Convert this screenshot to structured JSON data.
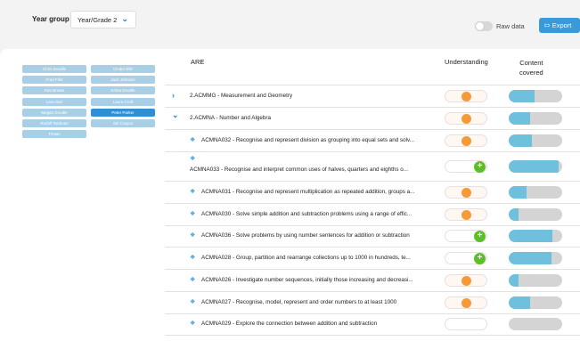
{
  "topbar": {
    "year_label": "Year group",
    "year_value": "Year/Grade 2",
    "raw_label": "Raw data",
    "export_label": "Export"
  },
  "students": [
    "Chris Doodle",
    "Cinder Elle",
    "Fred Flint",
    "Jack Johnson",
    "Ken Brown",
    "Krista Doodle",
    "Lara Star",
    "Laura Croft",
    "Megan Doodle",
    "Peter Parker",
    "Rodolf Redman",
    "Siri Crayon",
    "Tristan"
  ],
  "selected_student": "Peter Parker",
  "table": {
    "col_are": "ARE",
    "col_understanding": "Understanding",
    "col_content_1": "Content",
    "col_content_2": "covered"
  },
  "rows": [
    {
      "text": "2.ACMMG - Measurement and Geometry",
      "kind": "group",
      "expanded": false,
      "understanding": "orange",
      "covered": 0.48
    },
    {
      "text": "2.ACMNA - Number and Algebra",
      "kind": "group",
      "expanded": true,
      "understanding": "orange",
      "covered": 0.4
    },
    {
      "text": "ACMNA032 - Recognise and represent division as grouping into equal sets and solv...",
      "kind": "item",
      "understanding": "orange",
      "covered": 0.43
    },
    {
      "text": "ACMNA033 - Recognise and interpret common uses of halves, quarters and eighths o...",
      "kind": "item-wrap",
      "understanding": "plus",
      "covered": 0.93
    },
    {
      "text": "ACMNA031 - Recognise and represent multiplication as repeated addition, groups a...",
      "kind": "item",
      "understanding": "orange",
      "covered": 0.33
    },
    {
      "text": "ACMNA030 - Solve simple addition and subtraction problems using a range of effic...",
      "kind": "item",
      "understanding": "orange",
      "covered": 0.18
    },
    {
      "text": "ACMNA036 - Solve problems by using number sentences for addition or subtraction",
      "kind": "item",
      "understanding": "plus",
      "covered": 0.82
    },
    {
      "text": "ACMNA028 - Group, partition and rearrange collections up to 1000 in hundreds, te...",
      "kind": "item",
      "understanding": "plus",
      "covered": 0.8
    },
    {
      "text": "ACMNA026 - Investigate number sequences, initially those increasing and decreasi...",
      "kind": "item",
      "understanding": "orange",
      "covered": 0.18
    },
    {
      "text": "ACMNA027 - Recognise, model, represent and order numbers to at least 1000",
      "kind": "item",
      "understanding": "orange",
      "covered": 0.4
    },
    {
      "text": "ACMNA029 - Explore the connection between addition and subtraction",
      "kind": "item",
      "understanding": "empty",
      "covered": 0.0
    }
  ]
}
